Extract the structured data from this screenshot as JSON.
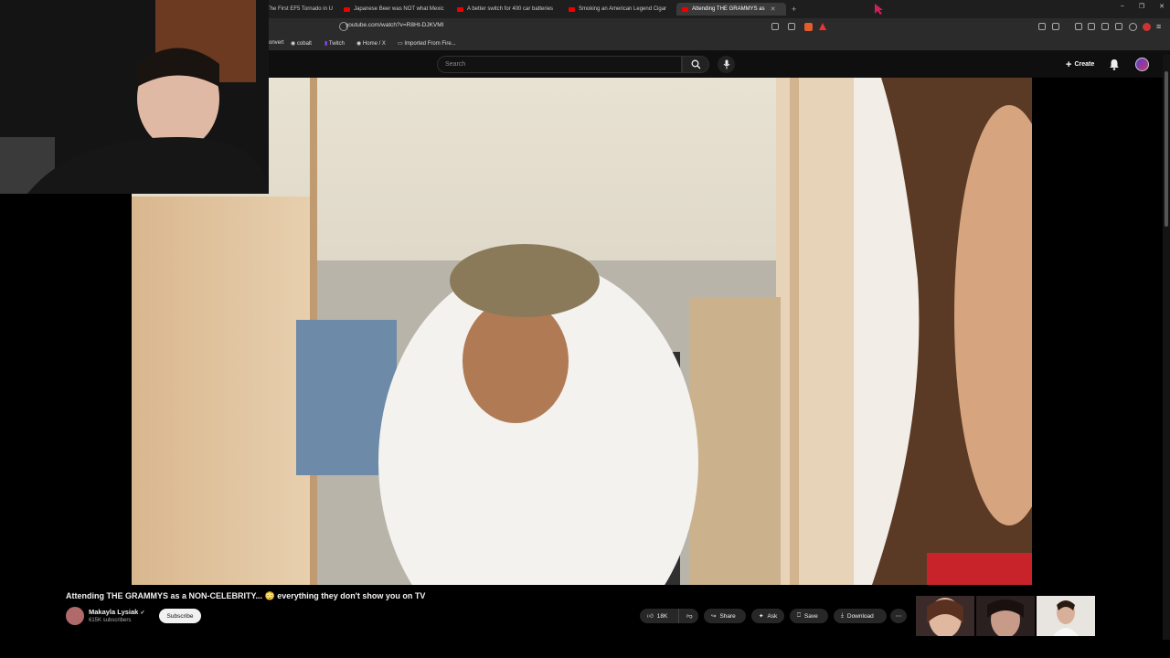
{
  "browser": {
    "tabs": [
      {
        "label": "The First EF5 Tornado in U",
        "active": false
      },
      {
        "label": "Japanese Beer was NOT what Mexic",
        "active": false
      },
      {
        "label": "A better switch for 400 car batteries",
        "active": false
      },
      {
        "label": "Smoking an American Legend Cigar",
        "active": false
      },
      {
        "label": "Attending THE GRAMMYS as",
        "active": true
      }
    ],
    "new_tab": "+",
    "url": "youtube.com/watch?v=R8Ht-DJKVMI",
    "bookmarks": [
      "onvert",
      "cobalt",
      "Twitch",
      "Home / X",
      "Imported From Fire..."
    ]
  },
  "youtube": {
    "search_placeholder": "Search",
    "create_label": "Create"
  },
  "video": {
    "title": "Attending THE GRAMMYS as a NON-CELEBRITY... 😳 everything they don't show you on TV",
    "channel": "Makayla Lysiak",
    "subscribers": "615K subscribers",
    "subscribe_label": "Subscribe",
    "likes": "18K",
    "share_label": "Share",
    "ask_label": "Ask",
    "save_label": "Save",
    "download_label": "Download"
  },
  "colors": {
    "youtube_red": "#ff0000",
    "background": "#0f0f0f",
    "pill": "#272727"
  }
}
